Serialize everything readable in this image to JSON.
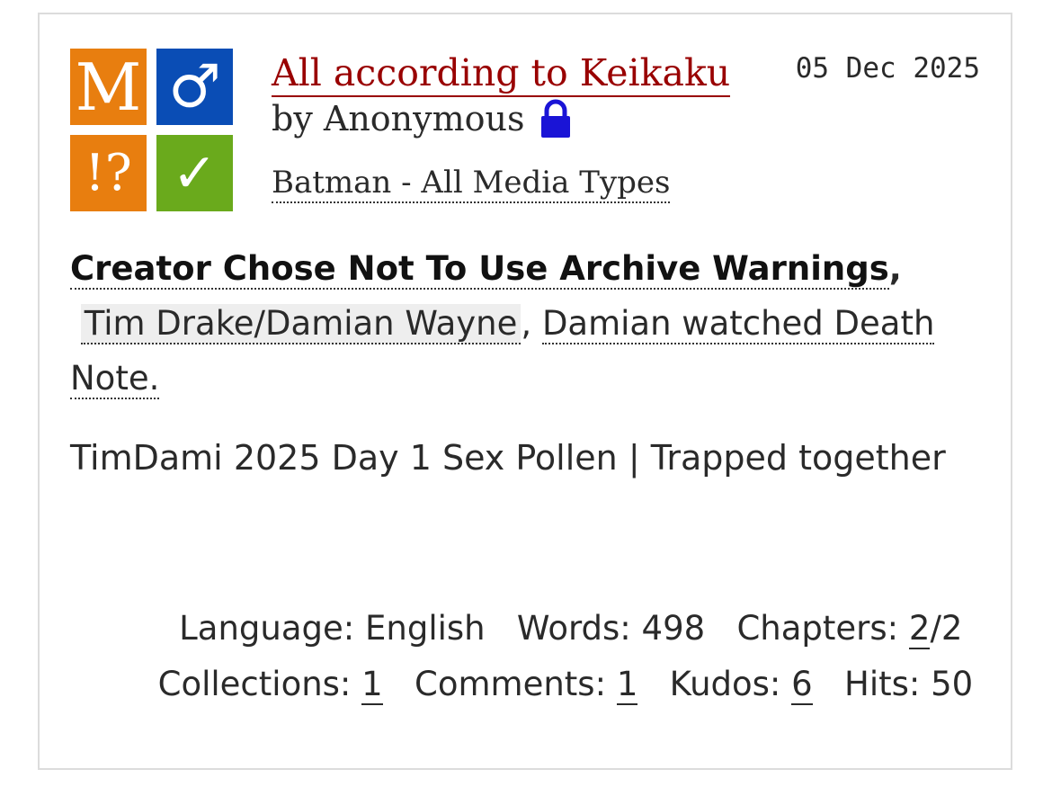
{
  "work": {
    "title": "All according to Keikaku",
    "byline_prefix": "by",
    "author": "Anonymous",
    "date": "05 Dec 2025",
    "fandom": "Batman - All Media Types",
    "icons": {
      "rating": "M",
      "category": "♂",
      "warnings": "!?",
      "complete": "✓"
    },
    "tags": {
      "warning": "Creator Chose Not To Use Archive Warnings",
      "relationship": "Tim Drake/Damian Wayne",
      "freeform": "Damian watched Death Note."
    },
    "summary": "TimDami 2025 Day 1 Sex Pollen | Trapped together",
    "stats": {
      "language_label": "Language:",
      "language": "English",
      "words_label": "Words:",
      "words": "498",
      "chapters_label": "Chapters:",
      "chapters_current": "2",
      "chapters_total": "/2",
      "collections_label": "Collections:",
      "collections": "1",
      "comments_label": "Comments:",
      "comments": "1",
      "kudos_label": "Kudos:",
      "kudos": "6",
      "hits_label": "Hits:",
      "hits": "50"
    }
  },
  "colors": {
    "title": "#990000",
    "rating_bg": "#e87e0f",
    "category_bg": "#0a4db5",
    "complete_bg": "#6aaa1c",
    "lock": "#1a14d6"
  }
}
